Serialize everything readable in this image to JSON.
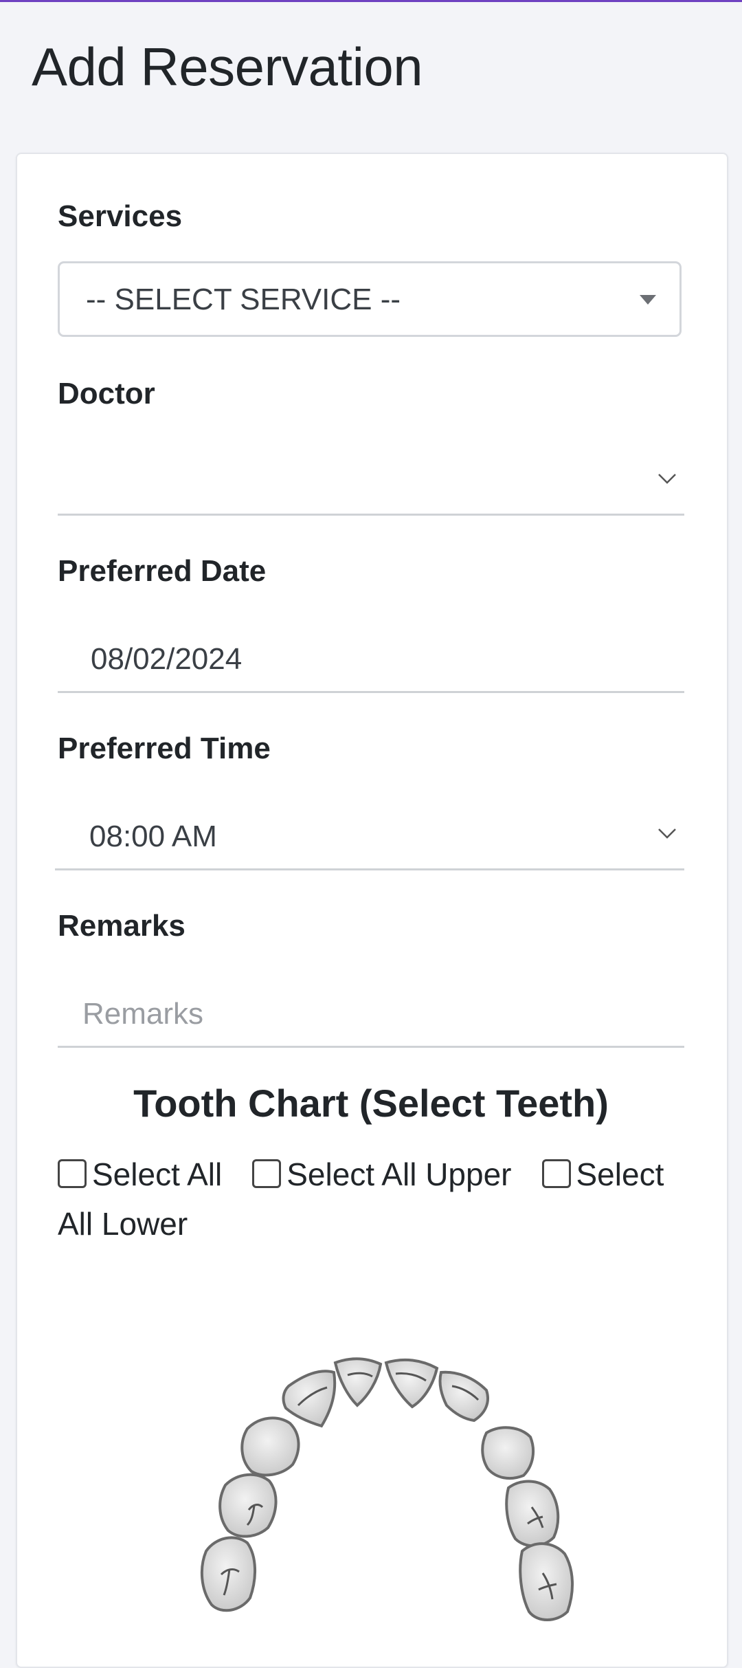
{
  "page": {
    "title": "Add Reservation",
    "accent_color": "#6f42c1"
  },
  "form": {
    "services": {
      "label": "Services",
      "value": "-- SELECT SERVICE --"
    },
    "doctor": {
      "label": "Doctor",
      "value": ""
    },
    "preferred_date": {
      "label": "Preferred Date",
      "value": "08/02/2024"
    },
    "preferred_time": {
      "label": "Preferred Time",
      "value": "08:00 AM"
    },
    "remarks": {
      "label": "Remarks",
      "placeholder": "Remarks"
    }
  },
  "tooth_chart": {
    "title": "Tooth Chart (Select Teeth)",
    "select_all": "Select All",
    "select_all_upper": "Select All Upper",
    "select_all_lower": "Select All Lower"
  },
  "icons": {
    "services_caret": "caret-down-icon",
    "doctor_chevron": "chevron-down-icon",
    "time_chevron": "chevron-down-icon"
  }
}
